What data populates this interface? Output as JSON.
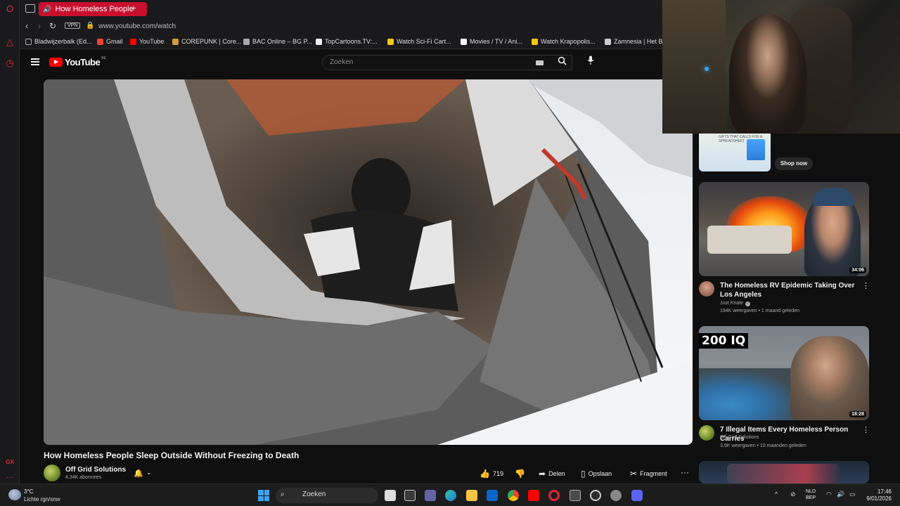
{
  "browser": {
    "active_tab_title": "How Homeless People",
    "address": "www.youtube.com/watch",
    "vpn_label": "VPN",
    "bookmarks": [
      {
        "label": "Bladwijzerbalk (Ed...",
        "color": "#888888"
      },
      {
        "label": "Gmail",
        "color": "#ea4335"
      },
      {
        "label": "YouTube",
        "color": "#ff0000"
      },
      {
        "label": "COREPUNK | Core...",
        "color": "#d49a3a"
      },
      {
        "label": "BAC Online – BG P...",
        "color": "#cccccc"
      },
      {
        "label": "TopCartoons.TV:...",
        "color": "#ffffff"
      },
      {
        "label": "Watch Sci-Fi Cart...",
        "color": "#f2c811"
      },
      {
        "label": "Movies / TV / Ani...",
        "color": "#ffffff"
      },
      {
        "label": "Watch Krapopolis...",
        "color": "#f2c811"
      },
      {
        "label": "Zamnesia | Het Be",
        "color": "#cccccc"
      }
    ]
  },
  "youtube": {
    "logo_text": "YouTube",
    "country_code": "BE",
    "search_placeholder": "Zoeken"
  },
  "video": {
    "title": "How Homeless People Sleep Outside Without Freezing to Death",
    "channel": "Off Grid Solutions",
    "subscribers": "4,34K abonnees",
    "likes": "719",
    "share_label": "Delen",
    "save_label": "Opslaan",
    "clip_label": "Fragment"
  },
  "sidebar": {
    "ad": {
      "thumb_text": "GIFTS THAT CALLS FOR A SPREADSHEET",
      "button": "Shop now"
    },
    "recommendations": [
      {
        "title": "The Homeless RV Epidemic Taking Over Los Angeles",
        "channel": "Just Knate",
        "meta": "194K weergaven • 1 maand geleden",
        "duration": "34:06"
      },
      {
        "title": "7 Illegal Items Every Homeless Person Carries",
        "channel": "Off Grid Solutions",
        "meta": "3,9K weergaven • 10 maanden geleden",
        "duration": "18:28",
        "badge": "200 IQ"
      }
    ]
  },
  "taskbar": {
    "temperature": "3°C",
    "weather": "Lichte rgn/snw",
    "search_label": "Zoeken",
    "lang_1": "NLD",
    "lang_2": "BEP",
    "time": "17:46",
    "date": "9/01/2026"
  }
}
